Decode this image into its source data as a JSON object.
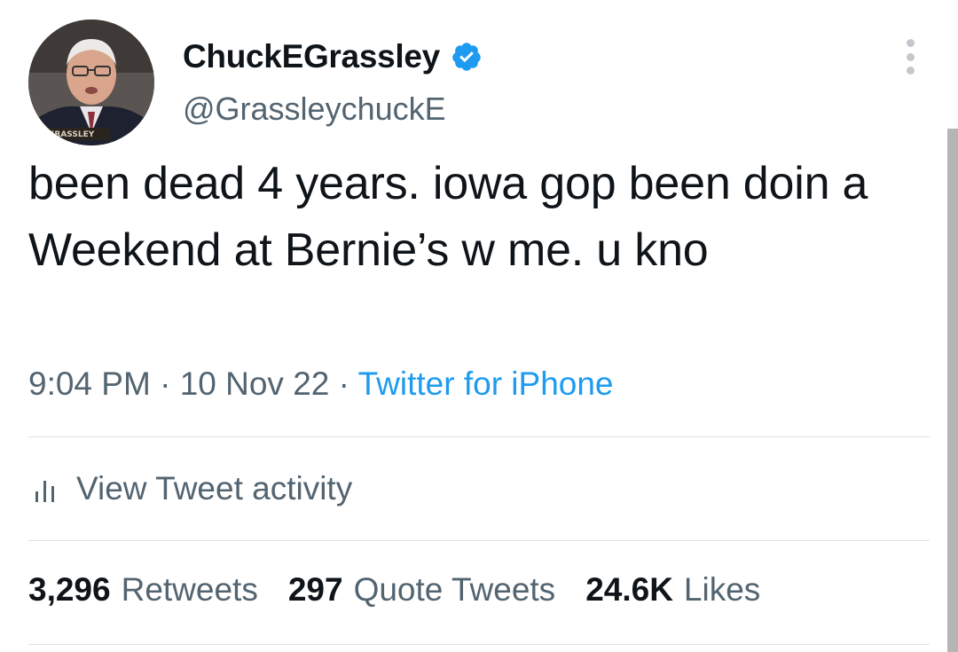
{
  "user": {
    "display_name": "ChuckEGrassley",
    "handle": "@GrassleychuckE",
    "avatar_nameplate": "GRASSLEY",
    "verified_color": "#1d9bf0"
  },
  "tweet": {
    "text": "been dead 4 years. iowa gop been doin a Weekend at Bernie’s w me. u kno",
    "time": "9:04 PM",
    "separator": "·",
    "date": "10 Nov 22",
    "source": "Twitter for iPhone"
  },
  "activity": {
    "label": "View Tweet activity"
  },
  "stats": {
    "retweets_count": "3,296",
    "retweets_label": "Retweets",
    "quotes_count": "297",
    "quotes_label": "Quote Tweets",
    "likes_count": "24.6K",
    "likes_label": "Likes"
  },
  "icons": {
    "more": "more-vertical-icon",
    "verified": "verified-badge-icon",
    "activity": "bar-chart-icon"
  }
}
